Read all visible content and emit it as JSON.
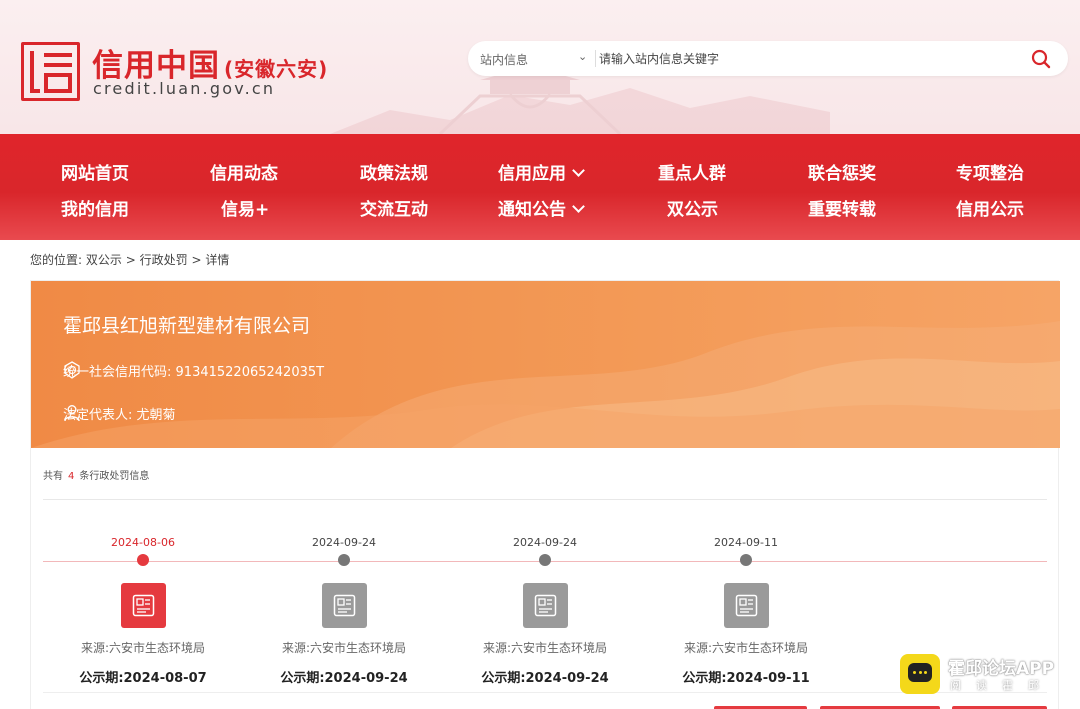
{
  "header": {
    "brand": "信用中国",
    "brand_region": "(安徽六安)",
    "domain": "credit.luan.gov.cn"
  },
  "search": {
    "scope": "站内信息",
    "placeholder": "请输入站内信息关键字"
  },
  "nav": {
    "row1": [
      "网站首页",
      "信用动态",
      "政策法规",
      "信用应用",
      "重点人群",
      "联合惩奖",
      "专项整治"
    ],
    "row2": [
      "我的信用",
      "信易+",
      "交流互动",
      "通知公告",
      "双公示",
      "重要转载",
      "信用公示"
    ]
  },
  "breadcrumb": {
    "prefix": "您的位置:",
    "items": [
      "双公示",
      "行政处罚",
      "详情"
    ],
    "sep": ">"
  },
  "company": {
    "name": "霍邱县红旭新型建材有限公司",
    "credit_code_label": "统一社会信用代码:",
    "credit_code": "91341522065242035T",
    "legal_rep_label": "法定代表人:",
    "legal_rep": "尤朝菊"
  },
  "records": {
    "total_prefix": "共有",
    "total": "4",
    "total_suffix": "条行政处罚信息",
    "source_label": "来源:",
    "pub_label": "公示期:",
    "items": [
      {
        "date": "2024-08-06",
        "source": "六安市生态环境局",
        "pub_date": "2024-08-07",
        "active": true
      },
      {
        "date": "2024-09-24",
        "source": "六安市生态环境局",
        "pub_date": "2024-09-24",
        "active": false
      },
      {
        "date": "2024-09-24",
        "source": "六安市生态环境局",
        "pub_date": "2024-09-24",
        "active": false
      },
      {
        "date": "2024-09-11",
        "source": "六安市生态环境局",
        "pub_date": "2024-09-11",
        "active": false
      }
    ]
  },
  "watermark": {
    "title": "霍邱论坛APP",
    "subtitle": "阅读霍邱"
  },
  "colors": {
    "brand_red": "#d9262b",
    "banner_orange": "#f08a45",
    "inactive_gray": "#9a9a9a"
  }
}
